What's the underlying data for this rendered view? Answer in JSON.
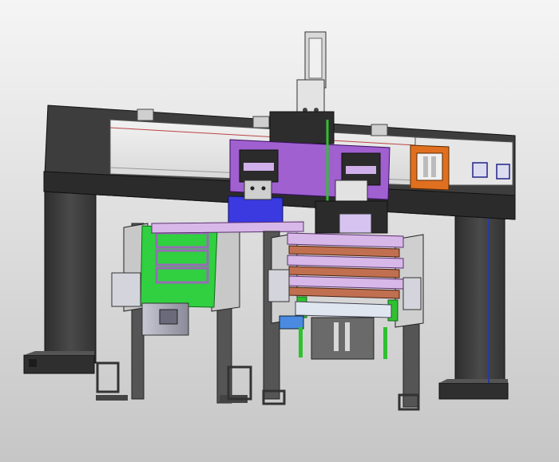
{
  "scene": {
    "subject": "cad-render-gantry-machine",
    "colors": {
      "background_top": "#f4f4f4",
      "background_bottom": "#c7c7c7",
      "frame_dark": "#3b3b3b",
      "frame_mid": "#4a4a4a",
      "rail_light": "#e8e8e8",
      "carriage_purple": "#a060d0",
      "block_blue": "#3a3ae0",
      "fixture_orange": "#e07020",
      "conveyor_green": "#30d040",
      "tray_pink": "#d8b8e8",
      "tray_brown": "#c07050",
      "motor_grey": "#9a9aa8",
      "accent_green_rod": "#30c030"
    }
  }
}
